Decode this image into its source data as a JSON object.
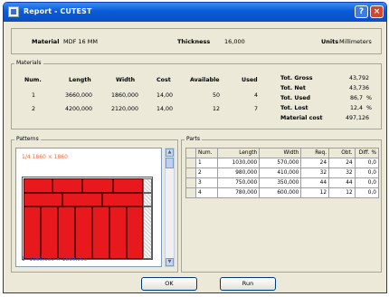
{
  "window": {
    "title": "Report - CUTEST",
    "help_glyph": "?",
    "close_glyph": "×"
  },
  "header": {
    "material_label": "Material",
    "material_value": "MDF 16 MM",
    "thickness_label": "Thickness",
    "thickness_value": "16,000",
    "units_label": "Units",
    "units_value": "Millimeters"
  },
  "materials": {
    "title": "Materials",
    "columns": [
      "Num.",
      "Length",
      "Width",
      "Cost",
      "Available",
      "Used"
    ],
    "rows": [
      [
        "1",
        "3660,000",
        "1860,000",
        "14,00",
        "50",
        "4"
      ],
      [
        "2",
        "4200,000",
        "2120,000",
        "14,00",
        "12",
        "7"
      ]
    ],
    "totals": [
      {
        "label": "Tot. Gross",
        "value": "43,792"
      },
      {
        "label": "Tot. Net",
        "value": "43,736"
      },
      {
        "label": "Tot. Used",
        "value": "86,7",
        "unit": "%"
      },
      {
        "label": "Tot. Lost",
        "value": "12,4",
        "unit": "%"
      },
      {
        "label": "Material cost",
        "value": "497,126"
      }
    ]
  },
  "patterns": {
    "title": "Patterns",
    "pattern_name": "1/4    1860 × 1860",
    "caption": "1° 1860,000 × 1860,000"
  },
  "parts": {
    "title": "Parts",
    "columns": [
      "Num.",
      "Length",
      "Width",
      "Req.",
      "Obt.",
      "Diff. %"
    ],
    "rows": [
      [
        "1",
        "1030,000",
        "570,000",
        "24",
        "24",
        "0,0"
      ],
      [
        "2",
        "980,000",
        "410,000",
        "32",
        "32",
        "0,0"
      ],
      [
        "3",
        "750,000",
        "350,000",
        "44",
        "44",
        "0,0"
      ],
      [
        "4",
        "780,000",
        "600,000",
        "12",
        "12",
        "0,0"
      ]
    ]
  },
  "buttons": {
    "ok": "OK",
    "run": "Run"
  }
}
